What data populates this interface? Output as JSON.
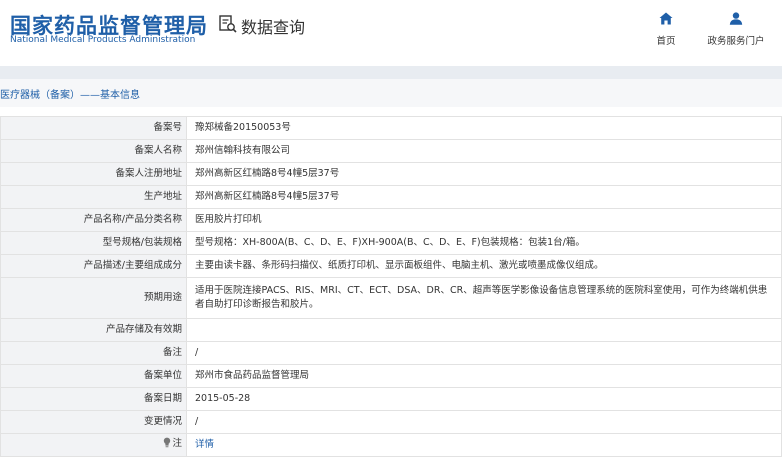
{
  "header": {
    "logo_cn": "国家药品监督管理局",
    "logo_en": "National Medical Products Administration",
    "data_query_label": "数据查询",
    "nav": {
      "home_label": "首页",
      "gov_label": "政务服务门户"
    }
  },
  "breadcrumb": {
    "text": "医疗器械（备案）——基本信息"
  },
  "rows": [
    {
      "label": "备案号",
      "value": "豫郑械备20150053号"
    },
    {
      "label": "备案人名称",
      "value": "郑州信翰科技有限公司"
    },
    {
      "label": "备案人注册地址",
      "value": "郑州高新区红楠路8号4幢5层37号"
    },
    {
      "label": "生产地址",
      "value": "郑州高新区红楠路8号4幢5层37号"
    },
    {
      "label": "产品名称/产品分类名称",
      "value": "医用胶片打印机"
    },
    {
      "label": "型号规格/包装规格",
      "value": "型号规格：XH-800A(B、C、D、E、F)XH-900A(B、C、D、E、F)包装规格：包装1台/箱。"
    },
    {
      "label": "产品描述/主要组成成分",
      "value": "主要由读卡器、条形码扫描仪、纸质打印机、显示面板组件、电脑主机、激光或喷墨成像仪组成。"
    },
    {
      "label": "预期用途",
      "value": "适用于医院连接PACS、RIS、MRI、CT、ECT、DSA、DR、CR、超声等医学影像设备信息管理系统的医院科室使用，可作为终端机供患者自助打印诊断报告和胶片。"
    },
    {
      "label": "产品存储及有效期",
      "value": ""
    },
    {
      "label": "备注",
      "value": "/"
    },
    {
      "label": "备案单位",
      "value": "郑州市食品药品监督管理局"
    },
    {
      "label": "备案日期",
      "value": "2015-05-28"
    },
    {
      "label": "变更情况",
      "value": "/"
    }
  ],
  "note_row": {
    "label": "注",
    "link": "详情"
  },
  "colors": {
    "brand_blue": "#1f5fa8",
    "label_bg": "#f2f3f5",
    "band_bg": "#e8ecf1"
  }
}
